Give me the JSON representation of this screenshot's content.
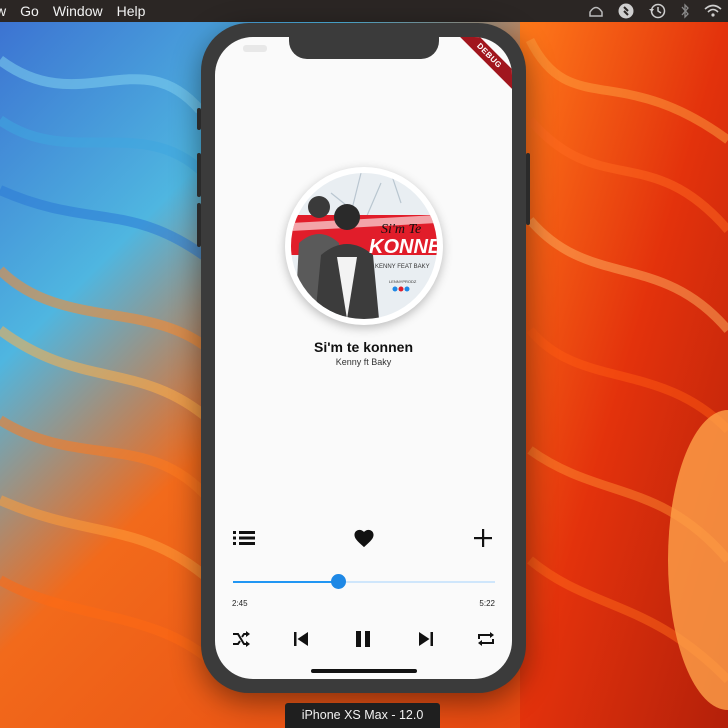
{
  "menubar": {
    "items": [
      "w",
      "Go",
      "Window",
      "Help"
    ],
    "status_icons": [
      "vpn-icon",
      "shazam-icon",
      "time-machine-icon",
      "bluetooth-icon",
      "wifi-icon"
    ]
  },
  "simulator": {
    "device_label": "iPhone XS Max - 12.0",
    "debug_banner": "DEBUG"
  },
  "player": {
    "album_art": {
      "title_art": "Si'm Te",
      "title_art_big": "KONNEN",
      "feat_art": "KENNY FEAT BAKY",
      "producer_art": "LENNYPRODZ"
    },
    "song_title": "Si'm te konnen",
    "artist": "Kenny ft Baky",
    "progress": {
      "current_time": "2:45",
      "total_time": "5:22",
      "position_fraction": 0.4
    },
    "actions": [
      "playlist-icon",
      "heart-icon",
      "add-icon"
    ],
    "controls": [
      "shuffle-icon",
      "previous-icon",
      "pause-icon",
      "next-icon",
      "repeat-icon"
    ],
    "colors": {
      "accent": "#1e88e5",
      "track": "#cfe6fb"
    }
  }
}
